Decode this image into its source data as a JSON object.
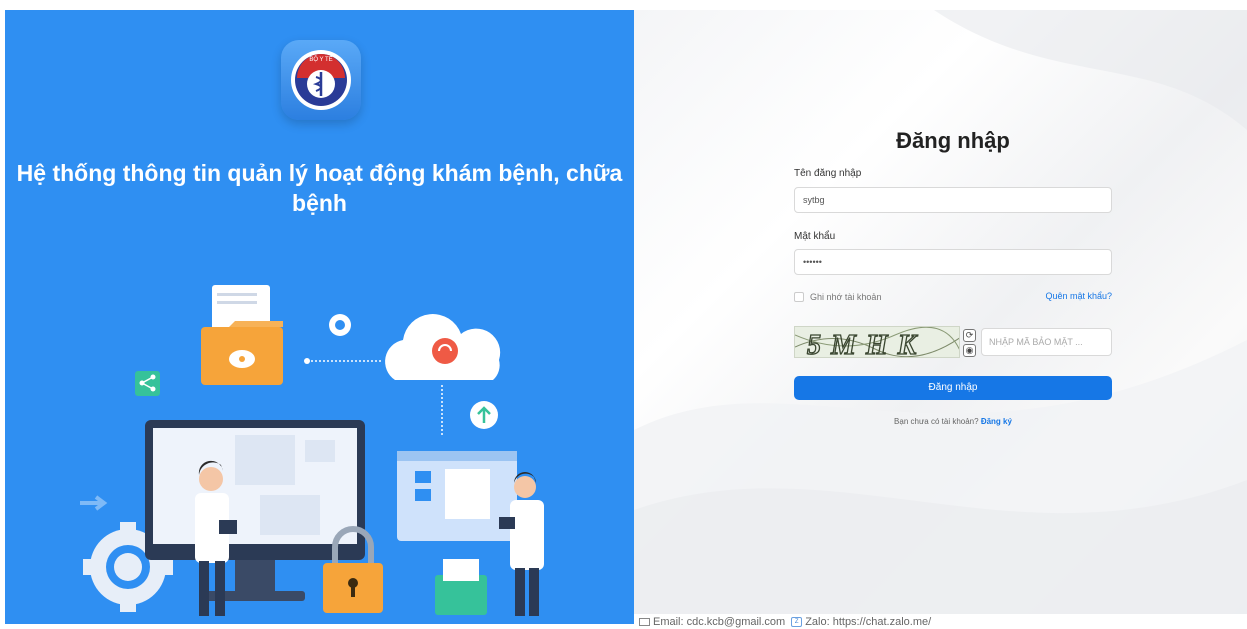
{
  "left": {
    "system_title": "Hệ thống thông tin quản lý hoạt động khám bệnh, chữa bệnh",
    "logo_text": "BỘ Y TẾ"
  },
  "login": {
    "title": "Đăng nhập",
    "username_label": "Tên đăng nhập",
    "username_value": "sytbg",
    "password_label": "Mật khẩu",
    "password_value": "••••••",
    "remember_label": "Ghi nhớ tài khoản",
    "forgot_link": "Quên mật khẩu?",
    "captcha_text": "5MHK",
    "captcha_placeholder": "NHẬP MÃ BẢO MẬT ...",
    "submit_label": "Đăng nhập",
    "no_account_text": "Bạn chưa có tài khoản?",
    "register_link": "Đăng ký"
  },
  "footer": {
    "email": "Email: cdc.kcb@gmail.com",
    "zalo": "Zalo: https://chat.zalo.me/"
  },
  "colors": {
    "left_bg": "#2f8ff2",
    "primary": "#1677e6"
  }
}
